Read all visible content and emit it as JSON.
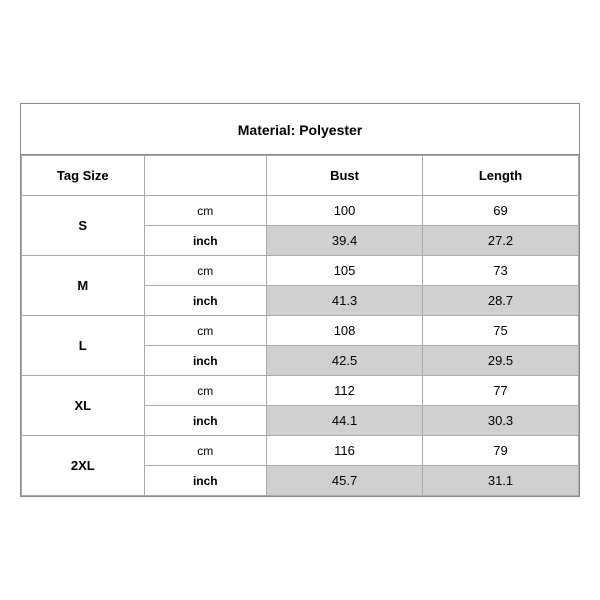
{
  "title": "Material: Polyester",
  "headers": {
    "tag_size": "Tag Size",
    "bust": "Bust",
    "length": "Length"
  },
  "rows": [
    {
      "size": "S",
      "cm": {
        "bust": "100",
        "length": "69"
      },
      "inch": {
        "bust": "39.4",
        "length": "27.2"
      }
    },
    {
      "size": "M",
      "cm": {
        "bust": "105",
        "length": "73"
      },
      "inch": {
        "bust": "41.3",
        "length": "28.7"
      }
    },
    {
      "size": "L",
      "cm": {
        "bust": "108",
        "length": "75"
      },
      "inch": {
        "bust": "42.5",
        "length": "29.5"
      }
    },
    {
      "size": "XL",
      "cm": {
        "bust": "112",
        "length": "77"
      },
      "inch": {
        "bust": "44.1",
        "length": "30.3"
      }
    },
    {
      "size": "2XL",
      "cm": {
        "bust": "116",
        "length": "79"
      },
      "inch": {
        "bust": "45.7",
        "length": "31.1"
      }
    }
  ],
  "unit_cm": "cm",
  "unit_inch": "inch"
}
